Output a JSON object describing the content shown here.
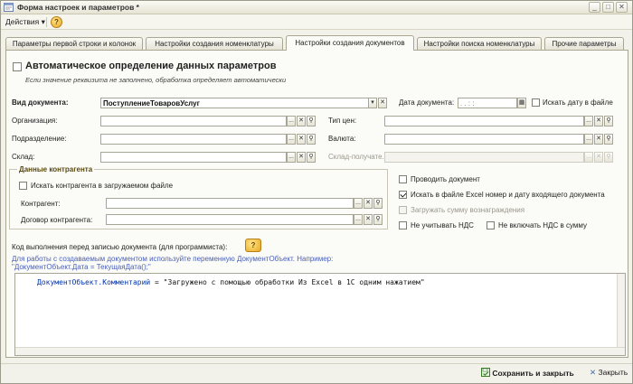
{
  "window": {
    "title": "Форма настроек и параметров *"
  },
  "toolbar": {
    "actions_label": "Действия",
    "actions_arrow": "▾",
    "help_glyph": "?"
  },
  "tabs": [
    {
      "label": "Параметры первой строки и колонок"
    },
    {
      "label": "Настройки создания номенклатуры"
    },
    {
      "label": "Настройки создания документов"
    },
    {
      "label": "Настройки поиска номенклатуры"
    },
    {
      "label": "Прочие параметры"
    }
  ],
  "main": {
    "auto_detect_label": "Автоматическое определение данных параметров",
    "auto_detect_hint": "Если значение реквизита не заполнено, обработка определяет автоматически",
    "doc_type_label": "Вид документа:",
    "doc_type_value": "ПоступлениеТоваровУслуг",
    "doc_date_label": "Дата документа:",
    "doc_date_value": ". .   : :",
    "search_date_label": "Искать дату в файле",
    "org_label": "Организация:",
    "price_type_label": "Тип цен:",
    "division_label": "Подразделение:",
    "currency_label": "Валюта:",
    "warehouse_label": "Склад:",
    "warehouse_recv_label": "Склад-получате..."
  },
  "contractor": {
    "group_title": "Данные контрагента",
    "search_label": "Искать контрагента в загружаемом файле",
    "counterparty_label": "Контрагент:",
    "contract_label": "Договор контрагента:"
  },
  "right_options": {
    "post_doc_label": "Проводить документ",
    "search_excel_label": "Искать в файле Excel номер и дату входящего документа",
    "load_reward_label": "Загружать сумму вознаграждения",
    "no_vat_label": "Не учитывать НДС",
    "no_vat_sum_label": "Не включать НДС в сумму"
  },
  "code_section": {
    "label": "Код выполнения перед записью документа (для программиста):",
    "hint_line1": "Для работы с создаваемым документом используйте переменную ДокументОбъект. Например:",
    "hint_line2": "\"ДокументОбъект.Дата = ТекущаяДата();\"",
    "code_object": "ДокументОбъект.Комментарий",
    "code_rest": " = \"Загружено с помощью обработки Из Excel в 1С одним нажатием\""
  },
  "footer": {
    "save_label": "Сохранить и закрыть",
    "close_label": "Закрыть"
  },
  "icons": {
    "ellipsis": "...",
    "clear": "✕",
    "search": "⚲",
    "dropdown": "▾",
    "calendar": "▦",
    "minimize": "_",
    "maximize": "□",
    "close": "✕"
  }
}
